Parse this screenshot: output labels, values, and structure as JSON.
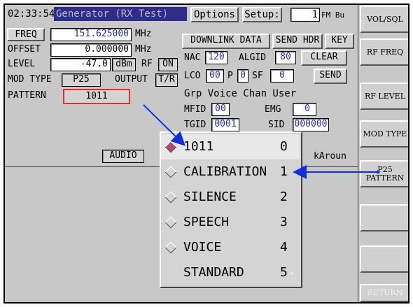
{
  "title_bar": {
    "time": "02:33:54",
    "mode": "Generator (RX Test)",
    "options": "Options",
    "setup": "Setup:",
    "setup_value": "1",
    "setup_unit": "FM Bu"
  },
  "left": {
    "freq": {
      "label": "FREQ",
      "value": "151.625000",
      "unit": "MHz"
    },
    "offset": {
      "label": "OFFSET",
      "value": "0.000000",
      "unit": "MHz"
    },
    "level": {
      "label": "LEVEL",
      "value": "-47.0",
      "unit": "dBm",
      "rf": "RF",
      "rf_state": "ON"
    },
    "mod_type": {
      "label": "MOD TYPE",
      "value": "P25",
      "output": "OUTPUT",
      "output_value": "T/R"
    },
    "pattern": {
      "label": "PATTERN",
      "value": "1011"
    },
    "audio": "AUDIO"
  },
  "right": {
    "downlink_data": "DOWNLINK DATA",
    "send_hdr": "SEND HDR",
    "key": "KEY",
    "nac_label": "NAC",
    "nac": "120",
    "algid_label": "ALGID",
    "algid": "80",
    "clear": "CLEAR",
    "lco_label": "LCO",
    "lco": "00",
    "p_label": "P",
    "p": "0",
    "sf_label": "SF",
    "sf": "0",
    "send": "SEND",
    "grp_voice": "Grp Voice Chan User",
    "mfid_label": "MFID",
    "mfid": "00",
    "emg_label": "EMG",
    "emg": "0",
    "tgid_label": "TGID",
    "tgid": "0001",
    "sid_label": "SID",
    "sid": "000000",
    "truncated": "kAroun"
  },
  "popup": {
    "items": [
      {
        "label": "1011",
        "num": "0"
      },
      {
        "label": "CALIBRATION",
        "num": "1"
      },
      {
        "label": "SILENCE",
        "num": "2"
      },
      {
        "label": "SPEECH",
        "num": "3"
      },
      {
        "label": "VOICE",
        "num": "4"
      },
      {
        "label": "STANDARD",
        "num": "5"
      }
    ],
    "more_arrow": "▸"
  },
  "sidebar": {
    "vol_sql": "VOL/SQL",
    "rf_freq": "RF FREQ",
    "rf_level": "RF LEVEL",
    "mod_type": "MOD TYPE",
    "p25_pattern_1": "P25",
    "p25_pattern_2": "PATTERN",
    "return": "RETURN"
  },
  "colors": {
    "highlight_box": "#e0302a",
    "arrow": "#1030e0",
    "selected_diamond": "#b04a6a",
    "value_blue": "#2a2ab0",
    "title_grey": "#b8b8c8"
  }
}
